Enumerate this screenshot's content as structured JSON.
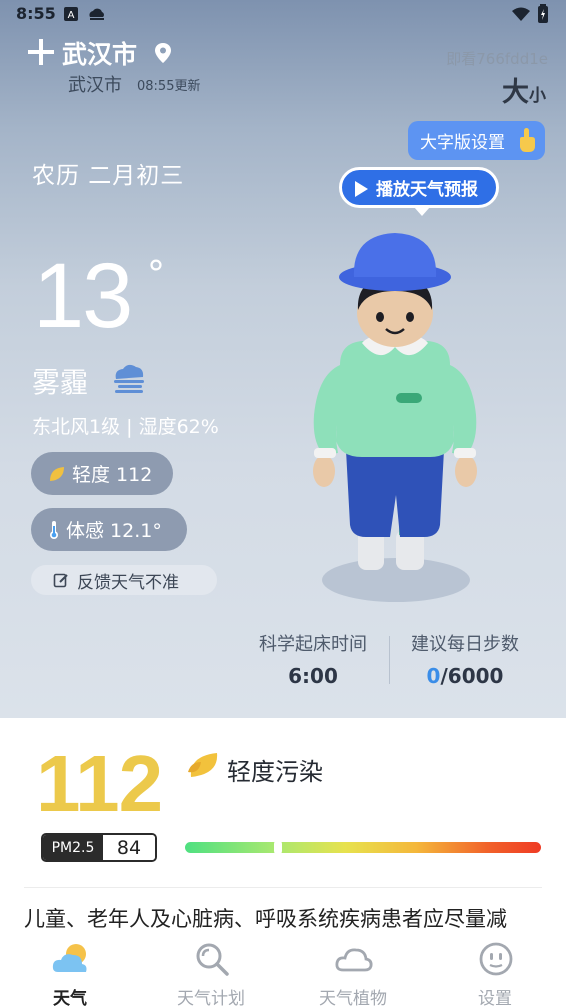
{
  "status_bar": {
    "time": "8:55"
  },
  "header": {
    "city": "武汉市",
    "sub_city": "武汉市",
    "update_time": "08:55更新",
    "user_id": "即看766fdd1e",
    "font_big": "大",
    "font_small": "小"
  },
  "bigfont_tip": {
    "label": "大字版设置"
  },
  "lunar_date": "农历 二月初三",
  "play_button": {
    "label": "播放天气预报"
  },
  "current": {
    "temperature": "13",
    "degree_symbol": "°",
    "condition": "雾霾",
    "wind_humidity": "东北风1级 | 湿度62%",
    "aqi_pill": "轻度 112",
    "feels_like": "体感 12.1°",
    "feedback": "反馈天气不准"
  },
  "stats": {
    "wake_label": "科学起床时间",
    "wake_value": "6:00",
    "steps_label": "建议每日步数",
    "steps_current": "0",
    "steps_target": "/6000"
  },
  "air_quality": {
    "aqi": "112",
    "level": "轻度污染",
    "pm_label": "PM2.5",
    "pm_value": "84",
    "bar_position_fraction": 0.26,
    "advice": "儿童、老年人及心脏病、呼吸系统疾病患者应尽量减"
  },
  "tabs": [
    {
      "label": "天气",
      "icon": "weather-cloud-sun-icon",
      "active": true
    },
    {
      "label": "天气计划",
      "icon": "search-icon",
      "active": false
    },
    {
      "label": "天气植物",
      "icon": "cloud-icon",
      "active": false
    },
    {
      "label": "设置",
      "icon": "smiley-icon",
      "active": false
    }
  ],
  "colors": {
    "aqi_yellow": "#ecc94b",
    "accent_blue": "#2f6fe6",
    "bubble_blue": "#5d94f2"
  }
}
